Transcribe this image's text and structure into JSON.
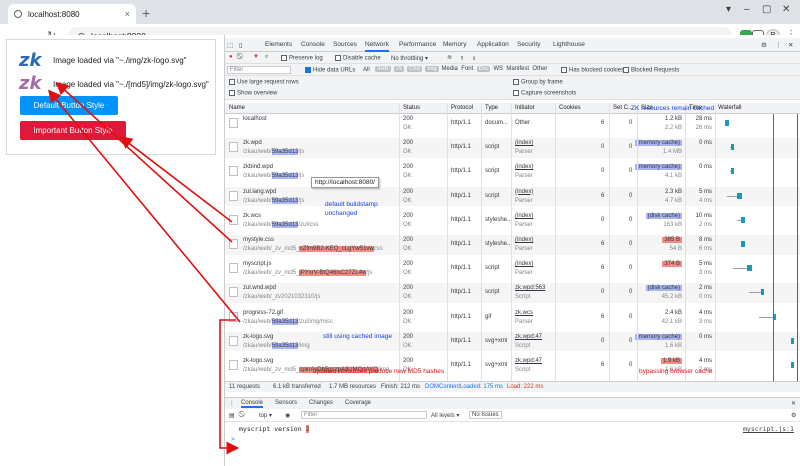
{
  "browser": {
    "tab_title": "localhost:8080",
    "tab_close": "×",
    "new_tab": "+",
    "address": "localhost:8080",
    "avatar_initial": "R",
    "window_controls": [
      "▾",
      "–",
      "▢",
      "✕"
    ]
  },
  "page": {
    "logo_text": "zk",
    "image_line_1": "Image loaded via \"~./img/zk-logo.svg\"",
    "image_line_2": "Image loaded via \"~./[md5]/img/zk-logo.svg\"",
    "default_button": "Default Button Style",
    "important_button": "Important Button Style"
  },
  "devtools": {
    "tabs": [
      "Elements",
      "Console",
      "Sources",
      "Network",
      "Performance",
      "Memory",
      "Application",
      "Security",
      "Lighthouse"
    ],
    "active_tab": "Network",
    "toolbar": {
      "preserve_log": "Preserve log",
      "disable_cache": "Disable cache",
      "throttling": "No throttling",
      "filter_placeholder": "Filter",
      "hide_data_urls": "Hide data URLs",
      "all": "All",
      "types": [
        "XHR",
        "JS",
        "CSS",
        "Img",
        "Media",
        "Font",
        "Doc",
        "WS",
        "Manifest",
        "Other"
      ],
      "has_blocked_cookies": "Has blocked cookies",
      "blocked_requests": "Blocked Requests",
      "use_large_rows": "Use large request rows",
      "group_by_frame": "Group by frame",
      "show_overview": "Show overview",
      "capture_screenshots": "Capture screenshots"
    },
    "columns": [
      "Name",
      "Status",
      "Protocol",
      "Type",
      "Initiator",
      "Cookies",
      "Set C...",
      "Size",
      "Time",
      "Waterfall"
    ],
    "rows": [
      {
        "name": "localhost",
        "path": "",
        "status": "200",
        "status_text": "OK",
        "protocol": "http/1.1",
        "type": "docum...",
        "initiator": "Other",
        "initiator_sub": "",
        "cookies": "6",
        "set_cookies": "0",
        "size": "1.2 kB",
        "size_sub": "2.2 kB",
        "size_style": "none",
        "time": "28 ms",
        "time_sub": "26 ms"
      },
      {
        "name": "zk.wpd",
        "path_pre": "/zkau/web/",
        "hash": "59a35d13",
        "path_post": "/js",
        "hash_style": "blue",
        "status": "200",
        "status_text": "OK",
        "protocol": "http/1.1",
        "type": "script",
        "initiator": "(index)",
        "initiator_sub": "Parser",
        "cookies": "0",
        "set_cookies": "0",
        "size": "(memory cache)",
        "size_sub": "1.4 MB",
        "size_style": "cache",
        "time": "0 ms",
        "time_sub": ""
      },
      {
        "name": "zkbind.wpd",
        "path_pre": "/zkau/web/",
        "hash": "59a35d13",
        "path_post": "/js",
        "hash_style": "blue",
        "status": "200",
        "status_text": "OK",
        "protocol": "http/1.1",
        "type": "script",
        "initiator": "(index)",
        "initiator_sub": "Parser",
        "cookies": "0",
        "set_cookies": "0",
        "size": "(memory cache)",
        "size_sub": "4.1 kB",
        "size_style": "cache",
        "time": "0 ms",
        "time_sub": ""
      },
      {
        "name": "zul.lang.wpd",
        "path_pre": "/zkau/web/",
        "hash": "59a35d13",
        "path_post": "/js",
        "hash_style": "blue",
        "status": "200",
        "status_text": "OK",
        "protocol": "http/1.1",
        "type": "script",
        "initiator": "(index)",
        "initiator_sub": "Parser",
        "cookies": "6",
        "set_cookies": "0",
        "size": "2.3 kB",
        "size_sub": "4.7 kB",
        "size_style": "none",
        "time": "5 ms",
        "time_sub": "4 ms"
      },
      {
        "name": "zk.wcs",
        "path_pre": "/zkau/web/",
        "hash": "59a35d13",
        "path_post": "/zul/css",
        "hash_style": "blue",
        "status": "200",
        "status_text": "OK",
        "protocol": "http/1.1",
        "type": "styleshe...",
        "initiator": "(index)",
        "initiator_sub": "Parser",
        "cookies": "0",
        "set_cookies": "0",
        "size": "(disk cache)",
        "size_sub": "163 kB",
        "size_style": "cache",
        "time": "10 ms",
        "time_sub": "2 ms"
      },
      {
        "name": "mystyle.css",
        "path_pre": "/zkau/web/_zv_md5_",
        "hash": "nZfm9B2-KEQ_cLgYw51vw",
        "path_post": "css",
        "hash_style": "red",
        "status": "200",
        "status_text": "OK",
        "protocol": "http/1.1",
        "type": "styleshe...",
        "initiator": "(index)",
        "initiator_sub": "Parser",
        "cookies": "6",
        "set_cookies": "0",
        "size": "385 B",
        "size_sub": "54 B",
        "size_style": "red",
        "time": "8 ms",
        "time_sub": "6 ms"
      },
      {
        "name": "myscript.js",
        "path_pre": "/zkau/web/_zv_md5_",
        "hash": "jPYxrV-BtQ46lxC27ZL4w",
        "path_post": "/js",
        "hash_style": "red",
        "status": "200",
        "status_text": "OK",
        "protocol": "http/1.1",
        "type": "script",
        "initiator": "(index)",
        "initiator_sub": "Parser",
        "cookies": "6",
        "set_cookies": "0",
        "size": "374 B",
        "size_sub": "",
        "size_style": "red",
        "time": "5 ms",
        "time_sub": "3 ms"
      },
      {
        "name": "zul.wnd.wpd",
        "path_pre": "/zkau/web/_zv2021032310/js",
        "hash": "",
        "path_post": "",
        "hash_style": "none",
        "status": "200",
        "status_text": "OK",
        "protocol": "http/1.1",
        "type": "script",
        "initiator": "zk.wpd:563",
        "initiator_sub": "Script",
        "cookies": "0",
        "set_cookies": "0",
        "size": "(disk cache)",
        "size_sub": "45.2 kB",
        "size_style": "cache",
        "time": "2 ms",
        "time_sub": "0 ms"
      },
      {
        "name": "progress-72.gif",
        "path_pre": "/zkau/web/",
        "hash": "59a35d13",
        "path_post": "/zul/img/misc",
        "hash_style": "blue",
        "status": "200",
        "status_text": "OK",
        "protocol": "http/1.1",
        "type": "gif",
        "initiator": "zk.wcs",
        "initiator_sub": "Parser",
        "cookies": "6",
        "set_cookies": "0",
        "size": "2.4 kB",
        "size_sub": "42.1 kB",
        "size_style": "none",
        "time": "4 ms",
        "time_sub": "3 ms"
      },
      {
        "name": "zk-logo.svg",
        "path_pre": "/zkau/web/",
        "hash": "59a35d13",
        "path_post": "/img",
        "hash_style": "blue",
        "status": "200",
        "status_text": "OK",
        "protocol": "http/1.1",
        "type": "svg+xml",
        "initiator": "zk.wpd:47",
        "initiator_sub": "Script",
        "cookies": "0",
        "set_cookies": "0",
        "size": "(memory cache)",
        "size_sub": "1.6 kB",
        "size_style": "cache",
        "time": "0 ms",
        "time_sub": ""
      },
      {
        "name": "zk-logo.svg",
        "path_pre": "/zkau/web/_zv_md5_",
        "hash": "cpinAyDh5gszpA8UMQdAYQ",
        "path_post": "/img",
        "hash_style": "red",
        "status": "200",
        "status_text": "OK",
        "protocol": "http/1.1",
        "type": "svg+xml",
        "initiator": "zk.wpd:47",
        "initiator_sub": "Script",
        "cookies": "6",
        "set_cookies": "0",
        "size": "1.9 kB",
        "size_sub": "1.6 kB",
        "size_style": "red",
        "time": "4 ms",
        "time_sub": "2 ms"
      }
    ],
    "summary": {
      "requests": "11 requests",
      "transferred": "6.1 kB transferred",
      "resources": "1.7 MB resources",
      "finish": "Finish: 212 ms",
      "dcl": "DOMContentLoaded: 175 ms",
      "load": "Load: 222 ms"
    },
    "drawer_tabs": [
      "Console",
      "Sensors",
      "Changes",
      "Coverage"
    ],
    "console": {
      "context": "top",
      "filter_placeholder": "Filter",
      "levels": "All levels ▾",
      "issues": "No Issues",
      "log_text": "myscript version",
      "log_value": "2",
      "log_source": "myscript.js:1",
      "prompt": ">"
    },
    "tooltip": "http://localhost:8080/"
  },
  "annotations": {
    "resources_cached": "ZK resources remain cached",
    "default_buildstamp": "default buildstamp",
    "unchanged": "unchanged",
    "still_cached": "still using cached image",
    "updated_hashes": "updated resources produce new MD5 hashes",
    "bypassing_cache": "bypassing browser cache"
  },
  "colors": {
    "accent": "#1a73e8",
    "default_button": "#0093f9",
    "important_button": "#e0193a",
    "annotation_red": "#e01010",
    "annotation_blue": "#1a3de0",
    "hash_blue": "#a8b4f5",
    "hash_red": "#f28b82"
  }
}
